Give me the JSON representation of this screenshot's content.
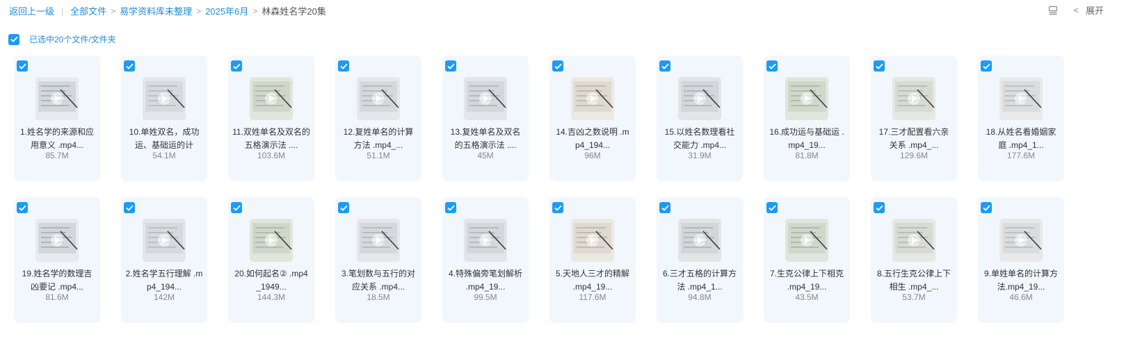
{
  "breadcrumb": {
    "back": "返回上一级",
    "items": [
      "全部文件",
      "易学资料库未整理",
      "2025年6月"
    ],
    "current": "林森姓名学20集"
  },
  "toolbar": {
    "expand_label": "展开"
  },
  "selection": {
    "text": "已选中20个文件/文件夹"
  },
  "files": [
    {
      "name": "1.姓名学的来源和应用意义 .mp4...",
      "size": "85.7M"
    },
    {
      "name": "10.单姓双名，成功运、基础运的计",
      "size": "54.1M"
    },
    {
      "name": "11.双姓单名及双名的五格演示法 ....",
      "size": "103.6M"
    },
    {
      "name": "12.复姓单名的计算方法 .mp4_...",
      "size": "51.1M"
    },
    {
      "name": "13.复姓单名及双名的五格演示法 ....",
      "size": "45M"
    },
    {
      "name": "14.吉凶之数说明 .mp4_194...",
      "size": "96M"
    },
    {
      "name": "15.以姓名数理看社交能力 .mp4...",
      "size": "31.9M"
    },
    {
      "name": "16.成功运与基础运 .mp4_19...",
      "size": "81.8M"
    },
    {
      "name": "17.三才配置看六亲关系 .mp4_...",
      "size": "129.6M"
    },
    {
      "name": "18.从姓名看婚姻家庭 .mp4_1...",
      "size": "177.6M"
    },
    {
      "name": "19.姓名学的数理吉凶要记 .mp4...",
      "size": "81.6M"
    },
    {
      "name": "2.姓名学五行理解 .mp4_194...",
      "size": "142M"
    },
    {
      "name": "20.如何起名② .mp4_1949...",
      "size": "144.3M"
    },
    {
      "name": "3.笔划数与五行的对应关系 .mp4...",
      "size": "18.5M"
    },
    {
      "name": "4.特殊偏旁笔划解析 .mp4_19...",
      "size": "99.5M"
    },
    {
      "name": "5.天地人三才的精解 .mp4_19...",
      "size": "117.6M"
    },
    {
      "name": "6.三才五格的计算方法 .mp4_1...",
      "size": "94.8M"
    },
    {
      "name": "7.生克公律上下相克 .mp4_19...",
      "size": "43.5M"
    },
    {
      "name": "8.五行生克公律上下相生 .mp4_...",
      "size": "53.7M"
    },
    {
      "name": "9.单姓单名的计算方法.mp4_19...",
      "size": "46.6M"
    }
  ],
  "colors": {
    "accent": "#1e9bf0",
    "link": "#1f8bd6",
    "card_bg": "#f1f7fd"
  },
  "icons": {
    "checkbox": "checkbox-checked-icon",
    "play": "play-icon",
    "list_view": "list-view-icon",
    "chevron": "chevron-left-icon"
  }
}
